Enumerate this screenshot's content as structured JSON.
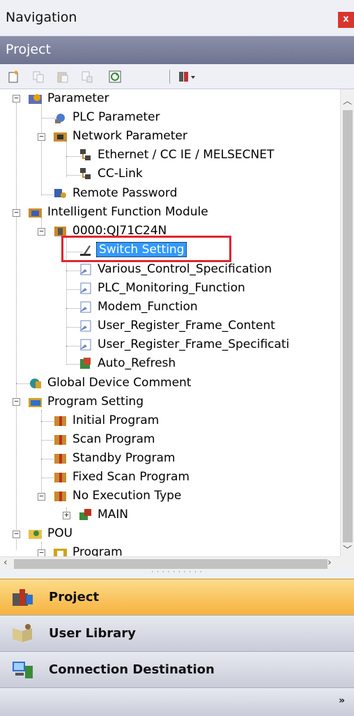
{
  "window": {
    "title": "Navigation",
    "close_icon": "close-icon"
  },
  "panel": {
    "header": "Project"
  },
  "toolbar": {
    "buttons": [
      "new-data-icon",
      "copy-icon",
      "paste-icon",
      "copy-data-icon",
      "refresh-icon",
      "filter-dropdown-icon"
    ]
  },
  "tree": {
    "items": [
      {
        "label": "Parameter",
        "icon": "parameter-folder-icon"
      },
      {
        "label": "PLC Parameter",
        "icon": "plc-parameter-icon"
      },
      {
        "label": "Network Parameter",
        "icon": "network-folder-icon"
      },
      {
        "label": "Ethernet / CC IE / MELSECNET",
        "icon": "network-node-icon"
      },
      {
        "label": "CC-Link",
        "icon": "network-node-icon"
      },
      {
        "label": "Remote Password",
        "icon": "password-icon"
      },
      {
        "label": "Intelligent Function Module",
        "icon": "module-folder-icon"
      },
      {
        "label": "0000:QJ71C24N",
        "icon": "module-icon"
      },
      {
        "label": "Switch Setting",
        "icon": "switch-setting-icon",
        "selected": true
      },
      {
        "label": "Various_Control_Specification",
        "icon": "setting-icon"
      },
      {
        "label": "PLC_Monitoring_Function",
        "icon": "setting-icon"
      },
      {
        "label": "Modem_Function",
        "icon": "setting-icon"
      },
      {
        "label": "User_Register_Frame_Content",
        "icon": "setting-icon"
      },
      {
        "label": "User_Register_Frame_Specificati",
        "icon": "setting-icon"
      },
      {
        "label": "Auto_Refresh",
        "icon": "auto-refresh-icon"
      },
      {
        "label": "Global Device Comment",
        "icon": "device-comment-icon"
      },
      {
        "label": "Program Setting",
        "icon": "program-setting-icon"
      },
      {
        "label": "Initial Program",
        "icon": "program-icon"
      },
      {
        "label": "Scan Program",
        "icon": "program-icon"
      },
      {
        "label": "Standby Program",
        "icon": "program-icon"
      },
      {
        "label": "Fixed Scan Program",
        "icon": "program-icon"
      },
      {
        "label": "No Execution Type",
        "icon": "program-icon"
      },
      {
        "label": "MAIN",
        "icon": "main-program-icon"
      },
      {
        "label": "POU",
        "icon": "pou-folder-icon"
      },
      {
        "label": "Program",
        "icon": "pou-program-icon"
      }
    ]
  },
  "bottom_tabs": [
    {
      "label": "Project",
      "icon": "project-icon",
      "active": true
    },
    {
      "label": "User Library",
      "icon": "user-library-icon",
      "active": false
    },
    {
      "label": "Connection Destination",
      "icon": "connection-destination-icon",
      "active": false
    }
  ],
  "colors": {
    "selection": "#3399ff",
    "highlight_box": "#e0252f",
    "active_tab": "#f6b23e",
    "header": "#6e7390"
  }
}
